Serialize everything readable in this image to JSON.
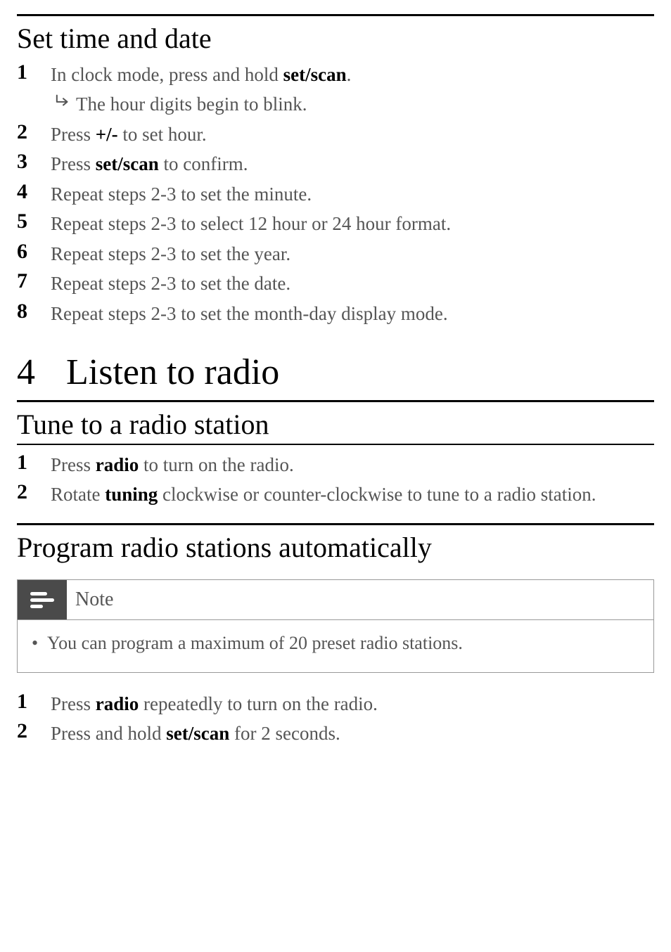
{
  "section1": {
    "title": "Set time and date",
    "steps": [
      {
        "n": "1",
        "pre": "In clock mode, press and hold ",
        "b": "set/scan",
        "post": ".",
        "sub": "The hour digits begin to blink."
      },
      {
        "n": "2",
        "pre": "Press ",
        "b": "+/-",
        "post": " to set hour."
      },
      {
        "n": "3",
        "pre": "Press ",
        "b": "set/scan",
        "post": " to confirm."
      },
      {
        "n": "4",
        "pre": "Repeat steps 2-3 to set the minute.",
        "b": "",
        "post": ""
      },
      {
        "n": "5",
        "pre": "Repeat steps 2-3 to select 12 hour or 24 hour format.",
        "b": "",
        "post": ""
      },
      {
        "n": "6",
        "pre": "Repeat steps 2-3 to set the year.",
        "b": "",
        "post": ""
      },
      {
        "n": "7",
        "pre": "Repeat steps 2-3 to set the date.",
        "b": "",
        "post": ""
      },
      {
        "n": "8",
        "pre": "Repeat steps 2-3 to set the month-day display mode.",
        "b": "",
        "post": ""
      }
    ]
  },
  "chapter": {
    "num": "4",
    "title": "Listen to radio"
  },
  "section2": {
    "title": "Tune to a radio station",
    "steps": [
      {
        "n": "1",
        "pre": "Press ",
        "b": "radio",
        "post": " to turn on the radio."
      },
      {
        "n": "2",
        "pre": "Rotate ",
        "b": "tuning",
        "post": " clockwise or counter-clockwise to tune to a radio station."
      }
    ]
  },
  "section3": {
    "title": "Program radio stations automatically",
    "note": {
      "label": "Note",
      "text": "You can program a maximum of 20 preset radio stations."
    },
    "steps": [
      {
        "n": "1",
        "pre": "Press ",
        "b": "radio",
        "post": " repeatedly to turn on the radio."
      },
      {
        "n": "2",
        "pre": "Press and hold ",
        "b": "set/scan",
        "post": " for 2 seconds."
      }
    ]
  }
}
